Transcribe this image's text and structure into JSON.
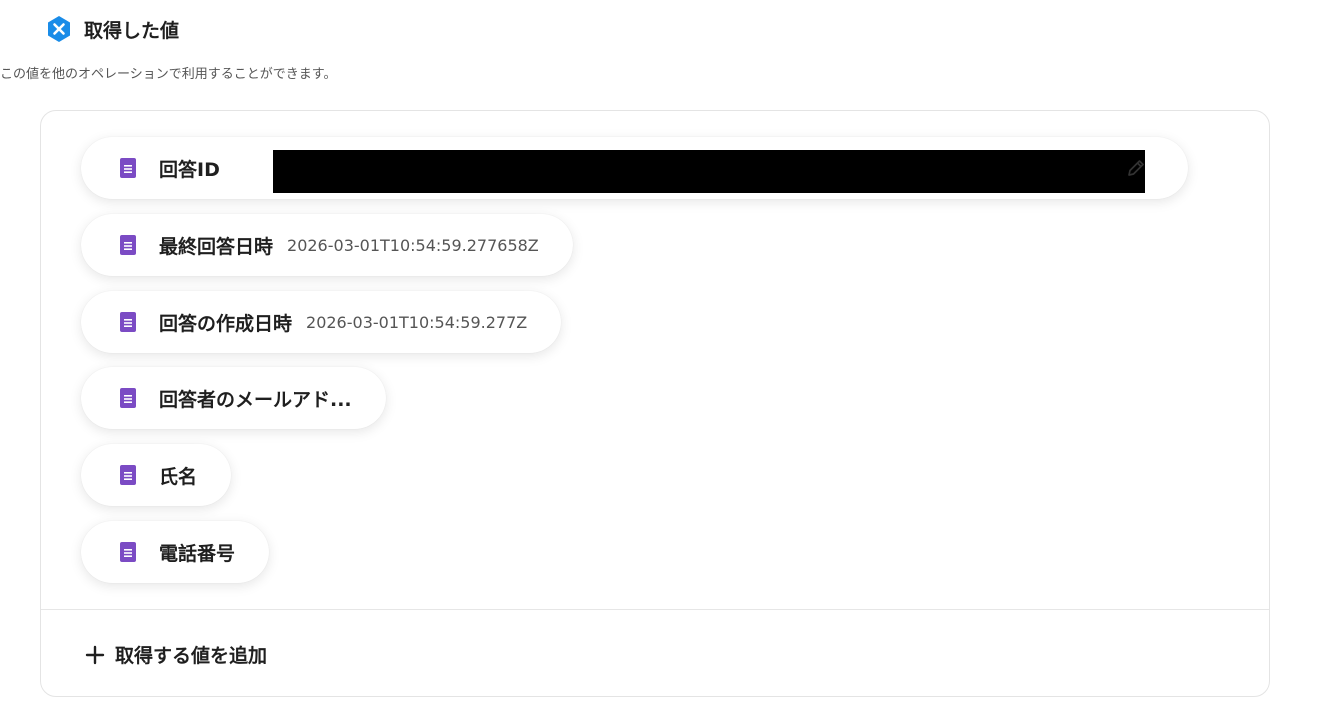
{
  "section": {
    "title": "取得した値",
    "description": "この値を他のオペレーションで利用することができます。",
    "badge_icon": "close-x-icon",
    "badge_color": "#1a8ce8"
  },
  "fields": [
    {
      "label": "回答ID",
      "value": "",
      "redacted": true,
      "editable": true
    },
    {
      "label": "最終回答日時",
      "value": "2026-03-01T10:54:59.277658Z"
    },
    {
      "label": "回答の作成日時",
      "value": "2026-03-01T10:54:59.277Z"
    },
    {
      "label": "回答者のメールアド...",
      "value": ""
    },
    {
      "label": "氏名",
      "value": ""
    },
    {
      "label": "電話番号",
      "value": ""
    }
  ],
  "field_icon": "google-forms-icon",
  "field_icon_color": "#7b4bc4",
  "edit_icon": "pencil-icon",
  "add_button": {
    "label": "取得する値を追加",
    "icon": "plus-icon"
  }
}
